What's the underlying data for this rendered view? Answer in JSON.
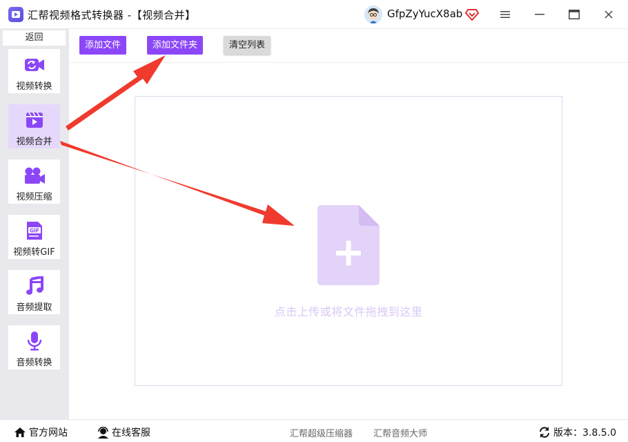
{
  "app": {
    "title": "汇帮视频格式转换器  -【视频合并】",
    "username": "GfpZyYucX8ab"
  },
  "sidebar": {
    "back_label": "返回",
    "items": [
      {
        "label": "视频转换",
        "icon": "video-convert-icon",
        "active": false
      },
      {
        "label": "视频合并",
        "icon": "video-merge-icon",
        "active": true
      },
      {
        "label": "视频压缩",
        "icon": "video-compress-icon",
        "active": false
      },
      {
        "label": "视频转GIF",
        "icon": "gif-icon",
        "active": false
      },
      {
        "label": "音频提取",
        "icon": "music-note-icon",
        "active": false
      },
      {
        "label": "音频转换",
        "icon": "microphone-icon",
        "active": false
      }
    ]
  },
  "toolbar": {
    "add_file": "添加文件",
    "add_folder": "添加文件夹",
    "clear_list": "清空列表"
  },
  "dropzone": {
    "hint": "点击上传或将文件拖拽到这里"
  },
  "footer": {
    "website": "官方网站",
    "support": "在线客服",
    "product1": "汇帮超级压缩器",
    "product2": "汇帮音频大师",
    "version": "版本：3.8.5.0"
  },
  "colors": {
    "accent": "#8b47f7",
    "active_bg": "#e6d8fb",
    "sidebar_bg": "#e9e9ed",
    "arrow": "#f03a2e",
    "drop_icon": "#e3d3f8"
  }
}
